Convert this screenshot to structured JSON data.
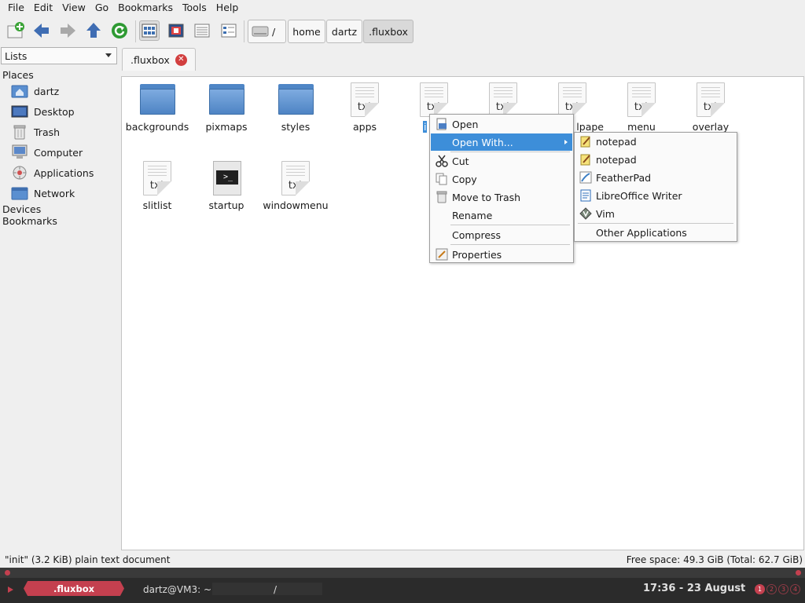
{
  "menubar": {
    "items": [
      "File",
      "Edit",
      "View",
      "Go",
      "Bookmarks",
      "Tools",
      "Help"
    ]
  },
  "toolbar": {
    "buttons": [
      "new-tab-icon",
      "back-arrow-icon",
      "forward-arrow-icon",
      "up-arrow-icon",
      "reload-icon",
      "icon-view-icon",
      "compact-view-icon",
      "detailed-list-view-icon",
      "thumbnail-view-icon"
    ],
    "breadcrumb": [
      "/",
      "home",
      "dartz",
      ".fluxbox"
    ]
  },
  "sidebar": {
    "mode": "Lists",
    "places_heading": "Places",
    "places": [
      {
        "label": "dartz",
        "icon": "home-folder-icon"
      },
      {
        "label": "Desktop",
        "icon": "desktop-icon"
      },
      {
        "label": "Trash",
        "icon": "trash-icon"
      },
      {
        "label": "Computer",
        "icon": "computer-icon"
      },
      {
        "label": "Applications",
        "icon": "applications-icon"
      },
      {
        "label": "Network",
        "icon": "network-icon"
      }
    ],
    "devices_heading": "Devices",
    "bookmarks_heading": "Bookmarks"
  },
  "tab": {
    "title": ".fluxbox"
  },
  "files": [
    {
      "name": "backgrounds",
      "type": "folder"
    },
    {
      "name": "pixmaps",
      "type": "folder"
    },
    {
      "name": "styles",
      "type": "folder"
    },
    {
      "name": "apps",
      "type": "txt"
    },
    {
      "name": "i",
      "type": "txt"
    },
    {
      "name": "",
      "type": "txt"
    },
    {
      "name": "lpape",
      "type": "txt"
    },
    {
      "name": "menu",
      "type": "txt"
    },
    {
      "name": "overlay",
      "type": "txt"
    },
    {
      "name": "slitlist",
      "type": "txt"
    },
    {
      "name": "startup",
      "type": "script"
    },
    {
      "name": "windowmenu",
      "type": "txt"
    }
  ],
  "file_icon_label": "txt",
  "file_script_label": ">_",
  "context_menu": {
    "open": "Open",
    "open_with": "Open With...",
    "cut": "Cut",
    "copy": "Copy",
    "move_to_trash": "Move to Trash",
    "rename": "Rename",
    "compress": "Compress",
    "properties": "Properties"
  },
  "submenu": {
    "apps": [
      {
        "label": "notepad",
        "icon": "notepad-icon"
      },
      {
        "label": "notepad",
        "icon": "notepad-icon"
      },
      {
        "label": "FeatherPad",
        "icon": "featherpad-icon"
      },
      {
        "label": "LibreOffice Writer",
        "icon": "libreoffice-writer-icon"
      },
      {
        "label": "Vim",
        "icon": "vim-icon"
      }
    ],
    "other": "Other Applications"
  },
  "statusbar": {
    "selection": "\"init\" (3.2 KiB) plain text document",
    "free_space": "Free space: 49.3 GiB (Total: 62.7 GiB)"
  },
  "panel": {
    "workspace": ".fluxbox",
    "window_title": "dartz@VM3: ~",
    "window_title2": "/",
    "clock": "17:36 - 23 August",
    "workspaces": [
      "1",
      "2",
      "3",
      "4"
    ]
  },
  "colors": {
    "accent": "#3d8ed9",
    "panel_accent": "#c4404f",
    "folder": "#5a8fd0"
  }
}
